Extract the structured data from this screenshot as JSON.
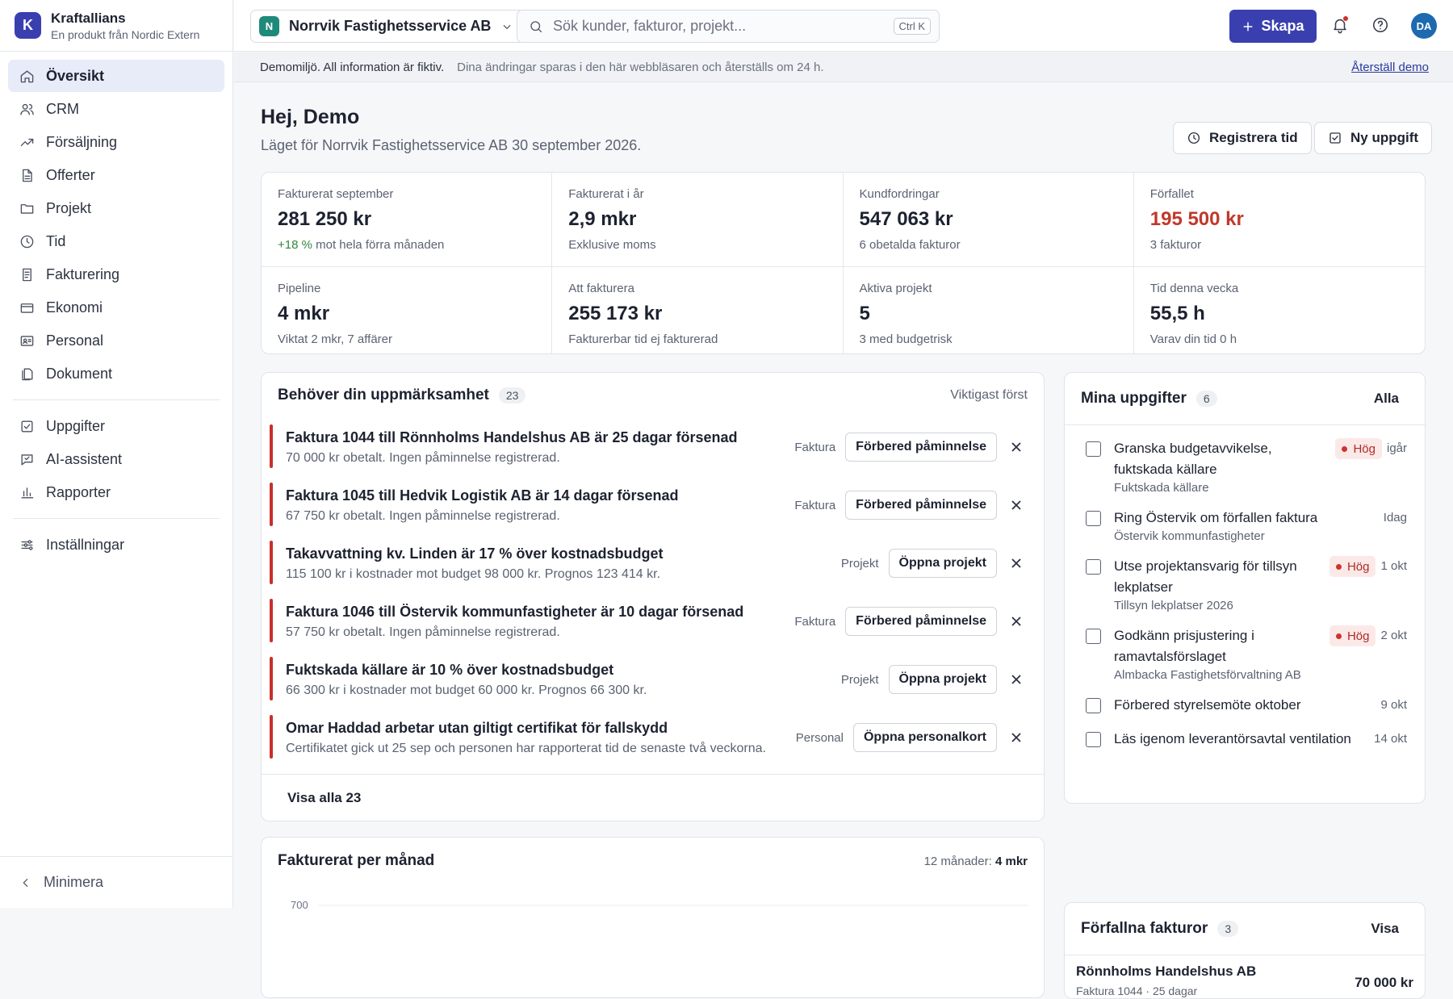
{
  "brand": {
    "logo_letter": "K",
    "name": "Kraftallians",
    "subtitle": "En produkt från Nordic Extern"
  },
  "nav": {
    "items": [
      {
        "label": "Översikt",
        "icon": "home-icon"
      },
      {
        "label": "CRM",
        "icon": "users-icon"
      },
      {
        "label": "Försäljning",
        "icon": "trend-icon"
      },
      {
        "label": "Offerter",
        "icon": "document-icon"
      },
      {
        "label": "Projekt",
        "icon": "folder-icon"
      },
      {
        "label": "Tid",
        "icon": "clock-icon"
      },
      {
        "label": "Fakturering",
        "icon": "invoice-icon"
      },
      {
        "label": "Ekonomi",
        "icon": "wallet-icon"
      },
      {
        "label": "Personal",
        "icon": "id-card-icon"
      },
      {
        "label": "Dokument",
        "icon": "files-icon"
      },
      {
        "label": "Uppgifter",
        "icon": "check-square-icon"
      },
      {
        "label": "AI-assistent",
        "icon": "chat-icon"
      },
      {
        "label": "Rapporter",
        "icon": "bar-chart-icon"
      },
      {
        "label": "Inställningar",
        "icon": "sliders-icon"
      }
    ],
    "minimize_label": "Minimera"
  },
  "topbar": {
    "company_logo_letter": "N",
    "company_name": "Norrvik Fastighetsservice AB",
    "search_placeholder": "Sök kunder, fakturor, projekt...",
    "search_shortcut": "Ctrl K",
    "create_label": "Skapa",
    "avatar_initials": "DA"
  },
  "banner": {
    "strong": "Demomiljö. All information är fiktiv.",
    "muted": "Dina ändringar sparas i den här webbläsaren och återställs om 24 h.",
    "link": "Återställ demo"
  },
  "greeting": {
    "title": "Hej, Demo",
    "subtitle": "Läget för Norrvik Fastighetsservice AB 30 september 2026.",
    "register_time_label": "Registrera tid",
    "new_task_label": "Ny uppgift"
  },
  "stats": [
    {
      "label": "Fakturerat september",
      "value": "281 250 kr",
      "sub_pos": "+18 %",
      "sub": " mot hela förra månaden"
    },
    {
      "label": "Fakturerat i år",
      "value": "2,9 mkr",
      "sub_pos": "",
      "sub": "Exklusive moms"
    },
    {
      "label": "Kundfordringar",
      "value": "547 063 kr",
      "sub_pos": "",
      "sub": "6 obetalda fakturor"
    },
    {
      "label": "Förfallet",
      "value": "195 500 kr",
      "sub_pos": "",
      "sub": "3 fakturor",
      "red": true
    },
    {
      "label": "Pipeline",
      "value": "4 mkr",
      "sub_pos": "",
      "sub": "Viktat 2 mkr, 7 affärer"
    },
    {
      "label": "Att fakturera",
      "value": "255 173 kr",
      "sub_pos": "",
      "sub": "Fakturerbar tid ej fakturerad"
    },
    {
      "label": "Aktiva projekt",
      "value": "5",
      "sub_pos": "",
      "sub": "3 med budgetrisk"
    },
    {
      "label": "Tid denna vecka",
      "value": "55,5 h",
      "sub_pos": "",
      "sub": "Varav din tid 0 h"
    }
  ],
  "attention": {
    "title": "Behöver din uppmärksamhet",
    "count": "23",
    "sort_label": "Viktigast först",
    "items": [
      {
        "title": "Faktura 1044 till Rönnholms Handelshus AB är 25 dagar försenad",
        "desc": "70 000 kr obetalt. Ingen påminnelse registrerad.",
        "type": "Faktura",
        "action": "Förbered påminnelse"
      },
      {
        "title": "Faktura 1045 till Hedvik Logistik AB är 14 dagar försenad",
        "desc": "67 750 kr obetalt. Ingen påminnelse registrerad.",
        "type": "Faktura",
        "action": "Förbered påminnelse"
      },
      {
        "title": "Takavvattning kv. Linden är 17 % över kostnadsbudget",
        "desc": "115 100 kr i kostnader mot budget 98 000 kr. Prognos 123 414 kr.",
        "type": "Projekt",
        "action": "Öppna projekt"
      },
      {
        "title": "Faktura 1046 till Östervik kommunfastigheter är 10 dagar försenad",
        "desc": "57 750 kr obetalt. Ingen påminnelse registrerad.",
        "type": "Faktura",
        "action": "Förbered påminnelse"
      },
      {
        "title": "Fuktskada källare är 10 % över kostnadsbudget",
        "desc": "66 300 kr i kostnader mot budget 60 000 kr. Prognos 66 300 kr.",
        "type": "Projekt",
        "action": "Öppna projekt"
      },
      {
        "title": "Omar Haddad arbetar utan giltigt certifikat för fallskydd",
        "desc": "Certifikatet gick ut 25 sep och personen har rapporterat tid de senaste två veckorna.",
        "type": "Personal",
        "action": "Öppna personalkort"
      }
    ],
    "show_all": "Visa alla 23"
  },
  "tasks": {
    "title": "Mina uppgifter",
    "count": "6",
    "all_label": "Alla",
    "items": [
      {
        "title": "Granska budgetavvikelse, fuktskada källare",
        "sub": "Fuktskada källare",
        "priority": "Hög",
        "date": "igår"
      },
      {
        "title": "Ring Östervik om förfallen faktura",
        "sub": "Östervik kommunfastigheter",
        "priority": "",
        "date": "Idag"
      },
      {
        "title": "Utse projektansvarig för tillsyn lekplatser",
        "sub": "Tillsyn lekplatser 2026",
        "priority": "Hög",
        "date": "1 okt"
      },
      {
        "title": "Godkänn prisjustering i ramavtalsförslaget",
        "sub": "Almbacka Fastighetsförvaltning AB",
        "priority": "Hög",
        "date": "2 okt"
      },
      {
        "title": "Förbered styrelsemöte oktober",
        "sub": "",
        "priority": "",
        "date": "9 okt"
      },
      {
        "title": "Läs igenom leverantörsavtal ventilation",
        "sub": "",
        "priority": "",
        "date": "14 okt"
      }
    ]
  },
  "chart": {
    "title": "Fakturerat per månad",
    "meta_prefix": "12 månader:",
    "meta_total": "4 mkr",
    "first_tick": "700"
  },
  "overdue": {
    "title": "Förfallna fakturor",
    "count": "3",
    "link": "Visa",
    "first_customer": "Rönnholms Handelshus AB",
    "first_invoice": "Faktura 1044 · 25 dagar",
    "first_amount": "70 000 kr"
  }
}
